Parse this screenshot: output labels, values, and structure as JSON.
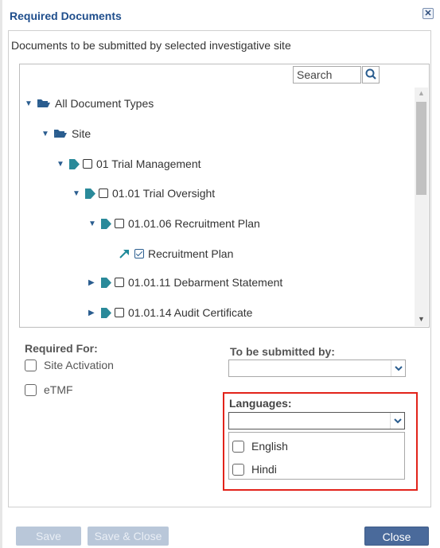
{
  "dialog": {
    "title": "Required Documents",
    "close_icon": "close-x-icon",
    "subtitle": "Documents to be submitted by selected investigative site"
  },
  "search": {
    "placeholder": "Search",
    "icon": "search-icon"
  },
  "tree": [
    {
      "label": "All Document Types",
      "level": 0,
      "expanded": true,
      "type": "folder"
    },
    {
      "label": "Site",
      "level": 1,
      "expanded": true,
      "type": "folder"
    },
    {
      "label": "01 Trial Management",
      "level": 2,
      "expanded": true,
      "type": "tag",
      "checked": false
    },
    {
      "label": "01.01 Trial Oversight",
      "level": 3,
      "expanded": true,
      "type": "tag",
      "checked": false
    },
    {
      "label": "01.01.06 Recruitment Plan",
      "level": 4,
      "expanded": true,
      "type": "tag",
      "checked": false
    },
    {
      "label": "Recruitment Plan",
      "level": 5,
      "type": "document",
      "checked": true
    },
    {
      "label": "01.01.11 Debarment Statement",
      "level": 4,
      "expanded": false,
      "type": "tag",
      "checked": false
    },
    {
      "label": "01.01.14 Audit Certificate",
      "level": 4,
      "expanded": false,
      "type": "tag",
      "checked": false
    }
  ],
  "required_for": {
    "label": "Required For:",
    "options": [
      {
        "label": "Site Activation",
        "checked": false
      },
      {
        "label": "eTMF",
        "checked": false
      }
    ]
  },
  "submitted_by": {
    "label": "To be submitted by:",
    "value": ""
  },
  "languages": {
    "label": "Languages:",
    "value": "",
    "options": [
      {
        "label": "English",
        "checked": false
      },
      {
        "label": "Hindi",
        "checked": false
      }
    ]
  },
  "footer": {
    "save_label": "Save",
    "save_close_label": "Save & Close",
    "close_label": "Close"
  },
  "colors": {
    "title": "#1f4e8c",
    "highlight": "#e2231a",
    "primary_button": "#4a6a9b",
    "disabled_button": "#b9c7d9",
    "tree_icon": "#2a8a9a"
  }
}
